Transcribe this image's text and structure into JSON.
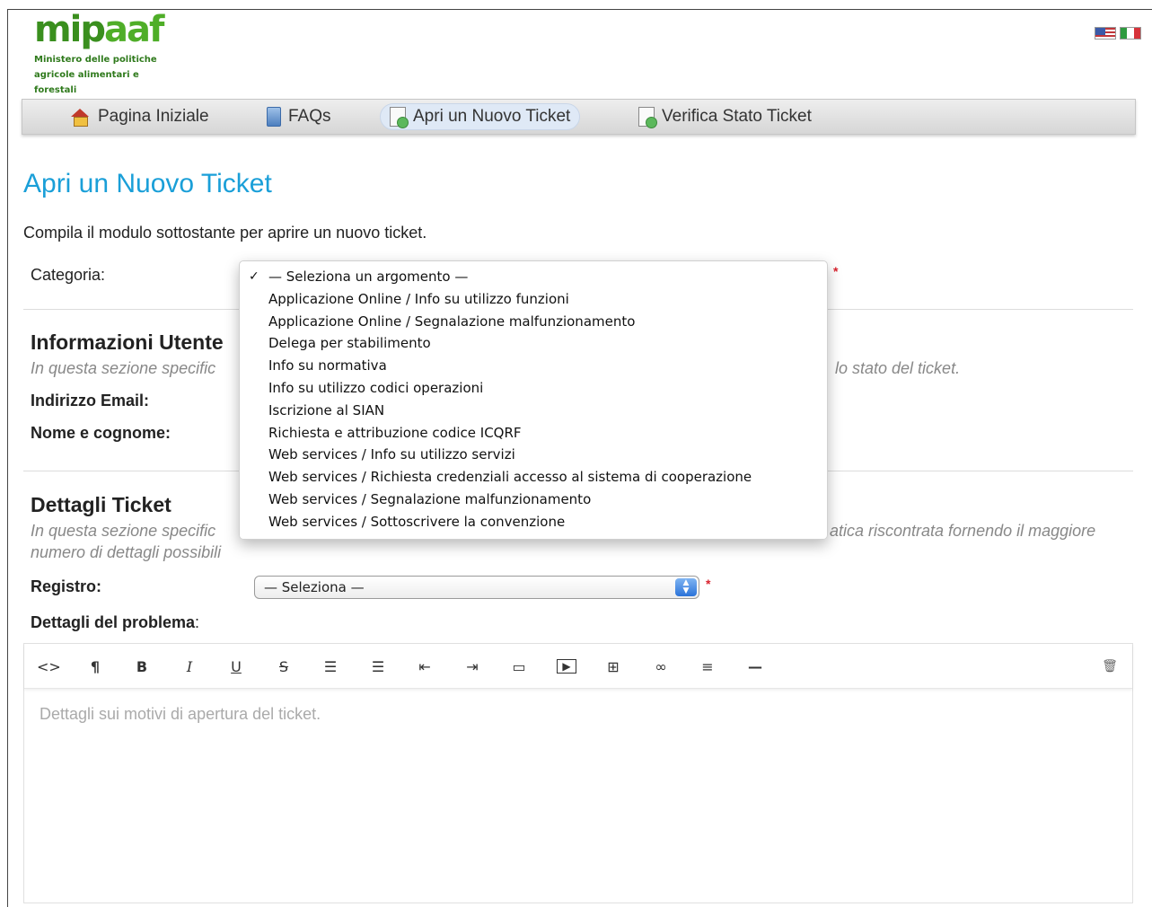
{
  "header": {
    "logo_text_a": "mip",
    "logo_text_b": "aaf",
    "logo_subtitle": "Ministero delle politiche agricole alimentari e forestali",
    "brand_color": "#3a8f1e"
  },
  "languages": [
    "english-flag-icon",
    "italian-flag-icon"
  ],
  "nav": {
    "items": [
      {
        "label": "Pagina Iniziale",
        "icon": "home-icon"
      },
      {
        "label": "FAQs",
        "icon": "faq-book-icon"
      },
      {
        "label": "Apri un Nuovo Ticket",
        "icon": "new-ticket-icon",
        "active": true
      },
      {
        "label": "Verifica Stato Ticket",
        "icon": "ticket-status-icon"
      }
    ]
  },
  "page": {
    "title": "Apri un Nuovo Ticket",
    "intro": "Compila il modulo sottostante per aprire un nuovo ticket.",
    "title_color": "#1a9fd8"
  },
  "form": {
    "category_label": "Categoria:",
    "required_mark": "*",
    "user_section": {
      "heading": "Informazioni Utente",
      "desc_left": "In questa sezione specific",
      "desc_right": "lo stato del ticket.",
      "email_label": "Indirizzo Email:",
      "name_label": "Nome e cognome:"
    },
    "ticket_section": {
      "heading": "Dettagli Ticket",
      "desc_line1_left": "In questa sezione specific",
      "desc_line1_right": "atica riscontrata fornendo il maggiore",
      "desc_line2": "numero di dettagli possibili",
      "registry_label": "Registro:",
      "registry_value": "— Seleziona —",
      "problem_label": "Dettagli del problema",
      "problem_label_suffix": ":"
    }
  },
  "editor": {
    "placeholder": "Dettagli sui motivi di apertura del ticket.",
    "toolbar": {
      "html": "<>",
      "paragraph": "¶",
      "bold": "B",
      "italic": "I",
      "underline": "U",
      "strike": "S",
      "unordered_list": "☰",
      "ordered_list": "☰",
      "outdent": "⇤",
      "indent": "⇥",
      "image": "▭",
      "video": "▶",
      "table": "⊞",
      "link": "∞",
      "align": "≡",
      "horizontal_rule": "—",
      "delete": "🗑"
    }
  },
  "dropdown": {
    "selected_check": "✓",
    "options": [
      "— Seleziona un argomento —",
      "Applicazione Online / Info su utilizzo funzioni",
      "Applicazione Online / Segnalazione malfunzionamento",
      "Delega per stabilimento",
      "Info su normativa",
      "Info su utilizzo codici operazioni",
      "Iscrizione al SIAN",
      "Richiesta e attribuzione codice ICQRF",
      "Web services / Info su utilizzo servizi",
      "Web services / Richiesta credenziali accesso al sistema di cooperazione",
      "Web services / Segnalazione malfunzionamento",
      "Web services / Sottoscrivere la convenzione"
    ]
  }
}
